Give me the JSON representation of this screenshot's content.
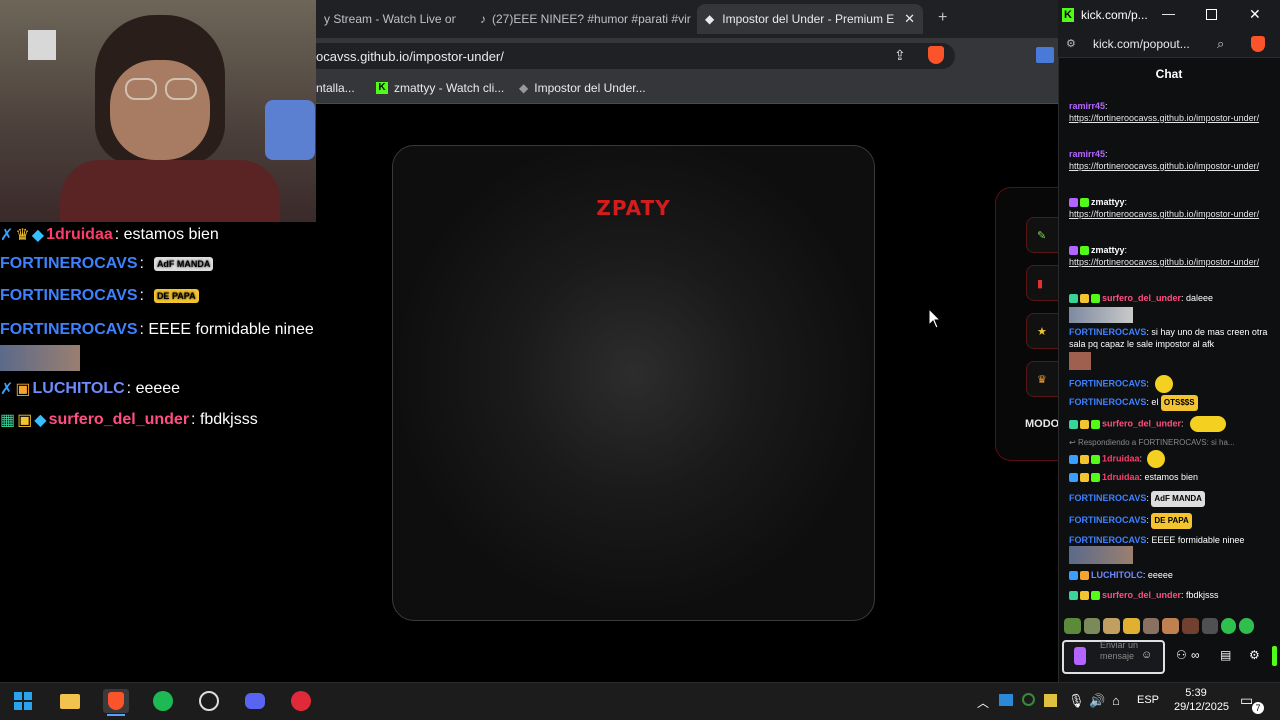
{
  "browser": {
    "tabs": [
      {
        "label": "y Stream - Watch Live on K"
      },
      {
        "label": "(27)EEE NINEE? #humor #parati #vir"
      },
      {
        "label": "Impostor del Under - Premium E"
      }
    ],
    "new_tab": "+",
    "url": "ocavss.github.io/impostor-under/",
    "bookmarks": [
      "ntalla...",
      "zmattyy - Watch cli...",
      "Impostor del Under..."
    ]
  },
  "page": {
    "logo": "ZPATY",
    "modo_label": "MODO"
  },
  "overlay_chat": [
    {
      "name": "1druidaa",
      "text": ": estamos bien",
      "color": "#ff3b6b"
    },
    {
      "name": "FORTINEROCAVS",
      "text": ":",
      "color": "#3e82ff",
      "emote": "AdF MANDA"
    },
    {
      "name": "FORTINEROCAVS",
      "text": ":",
      "color": "#3e82ff",
      "emote": "DE PAPA"
    },
    {
      "name": "FORTINEROCAVS",
      "text": ": EEEE formidable ninee",
      "color": "#3e82ff"
    },
    {
      "name": "LUCHITOLC",
      "text": ": eeeee",
      "color": "#6e8bff"
    },
    {
      "name": "surfero_del_under",
      "text": ": fbdkjsss",
      "color": "#ff4f82"
    }
  ],
  "kick": {
    "window_title": "kick.com/p...",
    "url": "kick.com/popout...",
    "chat_header": "Chat",
    "messages": [
      {
        "name": "ramirr45",
        "text": ":",
        "link": "https://fortineroocavss.github.io/impostor-under/",
        "color": "#b565ff"
      },
      {
        "name": "ramirr45",
        "text": ":",
        "link": "https://fortineroocavss.github.io/impostor-under/",
        "color": "#b565ff"
      },
      {
        "name": "zmattyy",
        "text": ":",
        "link": "https://fortineroocavss.github.io/impostor-under/",
        "color": "#ffffff"
      },
      {
        "name": "zmattyy",
        "text": ":",
        "link": "https://fortineroocavss.github.io/impostor-under/",
        "color": "#ffffff"
      },
      {
        "name": "surfero_del_under",
        "text": ": daleee",
        "color": "#ff4f82"
      },
      {
        "name": "FORTINEROCAVS",
        "text": ": si hay uno de mas creen otra sala pq capaz le sale impostor al afk",
        "color": "#3e82ff"
      },
      {
        "name": "FORTINEROCAVS",
        "text": ":",
        "color": "#3e82ff"
      },
      {
        "name": "FORTINEROCAVS",
        "text": ": el",
        "color": "#3e82ff"
      },
      {
        "name": "surfero_del_under",
        "text": ":",
        "color": "#ff4f82"
      },
      {
        "name": "Respondiendo a FORTINEROCAVS: si ha...",
        "text": "",
        "color": "#888888"
      },
      {
        "name": "1druidaa",
        "text": ":",
        "color": "#ff3b6b"
      },
      {
        "name": "1druidaa",
        "text": ": estamos bien",
        "color": "#ff3b6b"
      },
      {
        "name": "FORTINEROCAVS",
        "text": ":",
        "color": "#3e82ff"
      },
      {
        "name": "FORTINEROCAVS",
        "text": ":",
        "color": "#3e82ff"
      },
      {
        "name": "FORTINEROCAVS",
        "text": ": EEEE formidable ninee",
        "color": "#3e82ff"
      },
      {
        "name": "LUCHITOLC",
        "text": ": eeeee",
        "color": "#6e8bff"
      },
      {
        "name": "surfero_del_under",
        "text": ": fbdkjsss",
        "color": "#ff4f82"
      }
    ],
    "input_placeholder": "Enviar un mensaje",
    "emote_labels": {
      "ots": "OTS$$S",
      "de_papa": "DE PAPA",
      "adf": "AdF MANDA"
    }
  },
  "taskbar": {
    "language": "ESP",
    "time": "5:39",
    "date": "29/12/2025",
    "notifications": "7"
  },
  "colors": {
    "kick_green": "#53fc18",
    "accent_red": "#d51c1c"
  }
}
